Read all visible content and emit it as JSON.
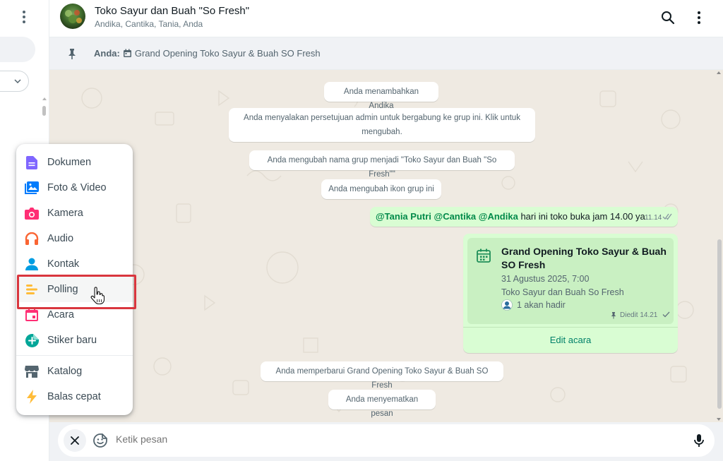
{
  "header": {
    "title": "Toko Sayur dan Buah \"So Fresh\"",
    "subtitle": "Andika, Cantika, Tania, Anda"
  },
  "pinned": {
    "sender": "Anda:",
    "text": "Grand Opening Toko Sayur & Buah SO Fresh"
  },
  "system_messages": [
    "Anda menambahkan Andika",
    "Anda menyalakan persetujuan admin untuk bergabung ke grup ini. Klik untuk mengubah.",
    "Anda mengubah nama grup menjadi \"Toko Sayur dan Buah \"So Fresh\"\"",
    "Anda mengubah ikon grup ini",
    "Anda memperbarui Grand Opening Toko Sayur & Buah SO Fresh",
    "Anda menyematkan pesan"
  ],
  "message": {
    "mentions": [
      "@Tania Putri",
      "@Cantika",
      "@Andika"
    ],
    "text": "hari ini toko buka jam 14.00 ya",
    "time": "11.14"
  },
  "event": {
    "title": "Grand Opening Toko Sayur & Buah SO Fresh",
    "date": "31 Agustus 2025, 7:00",
    "location": "Toko Sayur dan Buah So Fresh",
    "attendees": "1 akan hadir",
    "meta": "Diedit 14.21",
    "edit_label": "Edit acara"
  },
  "composer": {
    "placeholder": "Ketik pesan"
  },
  "attach_menu": {
    "items": [
      {
        "label": "Dokumen",
        "icon": "document-icon",
        "color": "#7f66ff"
      },
      {
        "label": "Foto & Video",
        "icon": "photo-video-icon",
        "color": "#007bfc"
      },
      {
        "label": "Kamera",
        "icon": "camera-icon",
        "color": "#ff2e74"
      },
      {
        "label": "Audio",
        "icon": "headphones-icon",
        "color": "#fa6533"
      },
      {
        "label": "Kontak",
        "icon": "contact-icon",
        "color": "#009de2"
      },
      {
        "label": "Polling",
        "icon": "poll-icon",
        "color": "#ffbc38"
      },
      {
        "label": "Acara",
        "icon": "event-icon",
        "color": "#ff2e74"
      },
      {
        "label": "Stiker baru",
        "icon": "sticker-icon",
        "color": "#02a698"
      },
      {
        "label": "Katalog",
        "icon": "catalog-icon",
        "color": "#54656f"
      },
      {
        "label": "Balas cepat",
        "icon": "quick-reply-icon",
        "color": "#ffbc38"
      }
    ]
  },
  "colors": {
    "outgoing_bubble": "#d9fdd3",
    "chat_bg": "#efeae2",
    "accent_green": "#008069",
    "highlight": "#d9363e"
  }
}
